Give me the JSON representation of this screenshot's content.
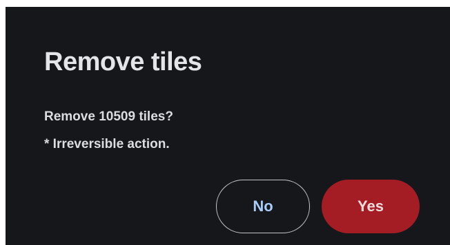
{
  "dialog": {
    "title": "Remove tiles",
    "message_line1": "Remove 10509 tiles?",
    "message_line2": "* Irreversible action.",
    "no_label": "No",
    "yes_label": "Yes"
  },
  "colors": {
    "background": "#15171b",
    "title_text": "#e4e5e8",
    "no_text": "#a8cdfb",
    "yes_background": "#a51d24"
  }
}
